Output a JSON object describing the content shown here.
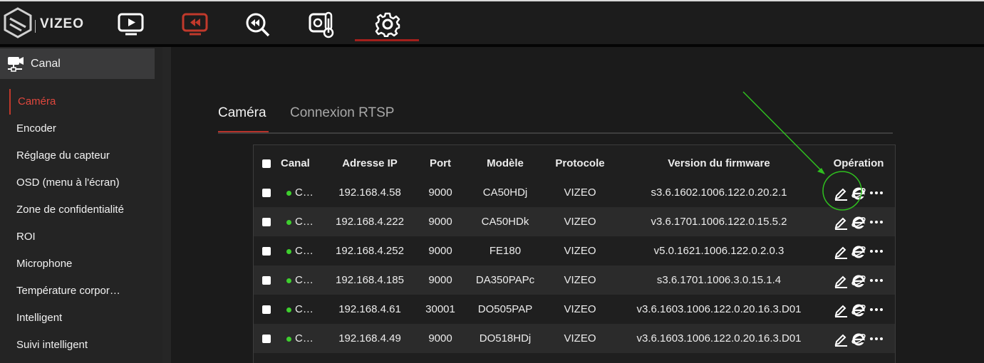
{
  "header": {
    "brand": "VIZEO",
    "nav": [
      {
        "name": "live-view",
        "icon": "monitor-play-icon"
      },
      {
        "name": "playback",
        "icon": "monitor-rewind-icon",
        "color": "#c0392b"
      },
      {
        "name": "search-playback",
        "icon": "magnifier-rewind-icon"
      },
      {
        "name": "thermal",
        "icon": "thermometer-camera-icon"
      },
      {
        "name": "settings",
        "icon": "gear-icon",
        "active": true
      }
    ]
  },
  "sidebar": {
    "section": "Canal",
    "section_icon": "camera-network-icon",
    "items": [
      {
        "label": "Caméra",
        "active": true
      },
      {
        "label": "Encoder"
      },
      {
        "label": "Réglage du capteur"
      },
      {
        "label": "OSD (menu à l'écran)"
      },
      {
        "label": "Zone de confidentialité"
      },
      {
        "label": "ROI"
      },
      {
        "label": "Microphone"
      },
      {
        "label": "Température corpor…"
      },
      {
        "label": "Intelligent"
      },
      {
        "label": "Suivi intelligent"
      }
    ]
  },
  "tabs": [
    {
      "label": "Caméra",
      "active": true
    },
    {
      "label": "Connexion RTSP"
    }
  ],
  "table": {
    "columns": [
      "Canal",
      "Adresse IP",
      "Port",
      "Modèle",
      "Protocole",
      "Version du firmware",
      "Opération"
    ],
    "rows": [
      {
        "canal": "C…",
        "ip": "192.168.4.58",
        "port": "9000",
        "model": "CA50HDj",
        "protocol": "VIZEO",
        "firmware": "s3.6.1602.1006.122.0.20.2.1"
      },
      {
        "canal": "C…",
        "ip": "192.168.4.222",
        "port": "9000",
        "model": "CA50HDk",
        "protocol": "VIZEO",
        "firmware": "v3.6.1701.1006.122.0.15.5.2"
      },
      {
        "canal": "C…",
        "ip": "192.168.4.252",
        "port": "9000",
        "model": "FE180",
        "protocol": "VIZEO",
        "firmware": "v5.0.1621.1006.122.0.2.0.3"
      },
      {
        "canal": "C…",
        "ip": "192.168.4.185",
        "port": "9000",
        "model": "DA350PAPc",
        "protocol": "VIZEO",
        "firmware": "s3.6.1701.1006.3.0.15.1.4"
      },
      {
        "canal": "C…",
        "ip": "192.168.4.61",
        "port": "30001",
        "model": "DO505PAP",
        "protocol": "VIZEO",
        "firmware": "v3.6.1603.1006.122.0.20.16.3.D01"
      },
      {
        "canal": "C…",
        "ip": "192.168.4.49",
        "port": "9000",
        "model": "DO518HDj",
        "protocol": "VIZEO",
        "firmware": "v3.6.1603.1006.122.0.20.16.3.D01"
      }
    ],
    "operation_icons": [
      "edit-icon",
      "browser-e-icon",
      "more-icon"
    ]
  },
  "colors": {
    "accent_red": "#c0392b",
    "status_online": "#3ecf2e",
    "annotation_green": "#2fbf1f"
  }
}
